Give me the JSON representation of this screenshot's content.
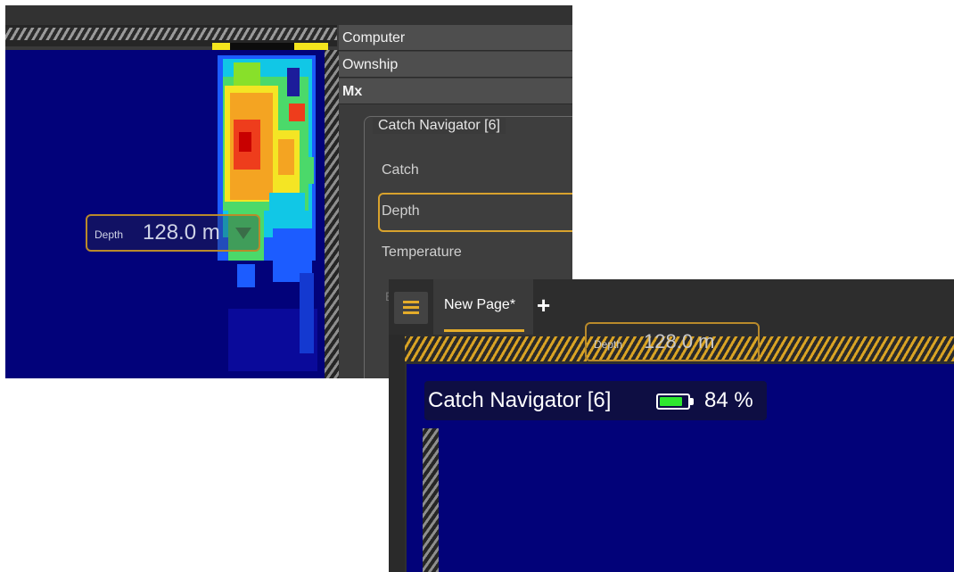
{
  "colors": {
    "accent": "#e4ac2a",
    "panel_bg": "#3b3b3b",
    "sonar_blue": "#02027a",
    "battery_green": "#2ee82e"
  },
  "left_window": {
    "menu_items": [
      "Computer",
      "Ownship",
      "Mx"
    ],
    "group_title": "Catch Navigator [6]",
    "options": [
      "Catch",
      "Depth",
      "Temperature"
    ],
    "selected_option": "Depth",
    "depth_readout": {
      "label": "Depth",
      "value": "128.0 m"
    }
  },
  "right_window": {
    "menu_icon": "hamburger-icon",
    "tab_label": "New Page*",
    "add_tab_icon": "plus-icon",
    "depth_readout": {
      "label": "Depth",
      "value": "128.0 m"
    },
    "status": {
      "title": "Catch Navigator [6]",
      "battery_icon": "battery-icon",
      "battery_level": 0.84,
      "battery_percent": "84 %"
    }
  }
}
